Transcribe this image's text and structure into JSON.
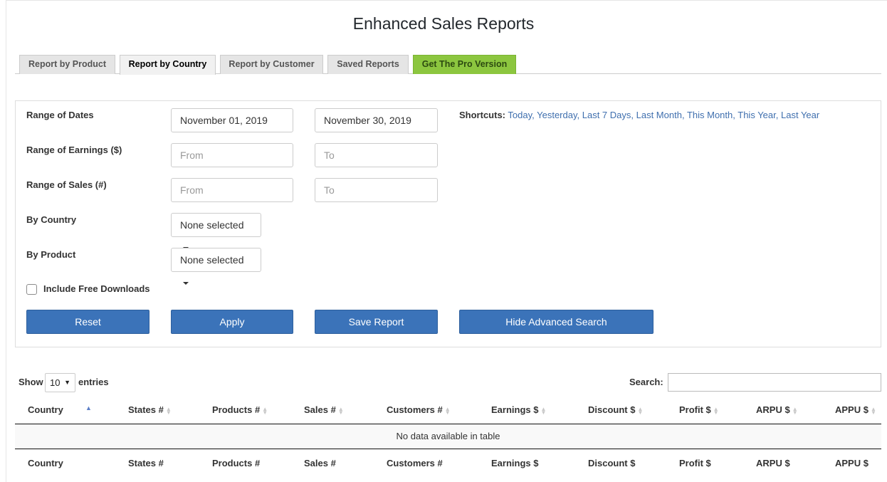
{
  "title": "Enhanced Sales Reports",
  "tabs": [
    {
      "label": "Report by Product"
    },
    {
      "label": "Report by Country"
    },
    {
      "label": "Report by Customer"
    },
    {
      "label": "Saved Reports"
    },
    {
      "label": "Get The Pro Version"
    }
  ],
  "filters": {
    "dates_label": "Range of Dates",
    "date_from": "November 01, 2019",
    "date_to": "November 30, 2019",
    "earnings_label": "Range of Earnings ($)",
    "earnings_from_ph": "From",
    "earnings_to_ph": "To",
    "sales_label": "Range of Sales (#)",
    "sales_from_ph": "From",
    "sales_to_ph": "To",
    "country_label": "By Country",
    "country_value": "None selected",
    "product_label": "By Product",
    "product_value": "None selected",
    "free_downloads_label": "Include Free Downloads",
    "free_downloads_checked": false
  },
  "shortcuts": {
    "label": "Shortcuts:",
    "links": [
      "Today",
      "Yesterday",
      "Last 7 Days",
      "Last Month",
      "This Month",
      "This Year",
      "Last Year"
    ]
  },
  "buttons": {
    "reset": "Reset",
    "apply": "Apply",
    "save": "Save Report",
    "hide_advanced": "Hide Advanced Search"
  },
  "table": {
    "show_label": "Show",
    "entries_value": "10",
    "entries_label": "entries",
    "search_label": "Search:",
    "columns": [
      "Country",
      "States #",
      "Products #",
      "Sales #",
      "Customers #",
      "Earnings $",
      "Discount $",
      "Profit $",
      "ARPU $",
      "APPU $"
    ],
    "empty_message": "No data available in table"
  }
}
